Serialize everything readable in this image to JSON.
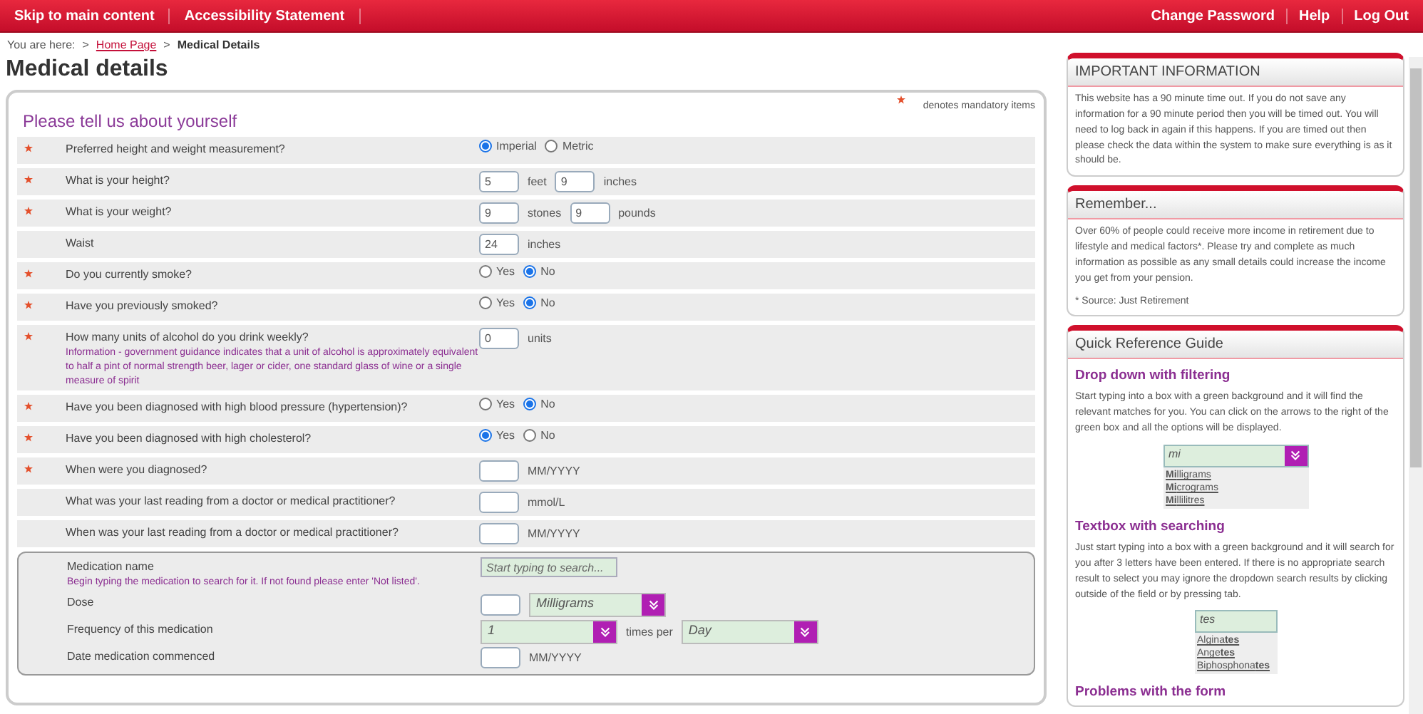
{
  "top_nav": {
    "left_links": [
      "Skip to main content",
      "Accessibility Statement"
    ],
    "right_links": [
      "Change Password",
      "Help",
      "Log Out"
    ]
  },
  "breadcrumb": {
    "prefix": "You are here:",
    "separator": ">",
    "links": [
      "Home Page"
    ],
    "current": "Medical Details"
  },
  "page_title": "Medical details",
  "form": {
    "mandatory_note": "denotes mandatory items",
    "section_title": "Please tell us about yourself",
    "rows": [
      {
        "label": "Preferred height and weight measurement?",
        "required": true,
        "controls": [
          {
            "kind": "radio",
            "label": "Imperial",
            "selected": true
          },
          {
            "kind": "radio",
            "label": "Metric",
            "selected": false
          }
        ]
      },
      {
        "label": "What is your height?",
        "required": true,
        "controls": [
          {
            "kind": "input",
            "value": "5"
          },
          {
            "kind": "unit",
            "text": "feet"
          },
          {
            "kind": "input",
            "value": "9"
          },
          {
            "kind": "unit",
            "text": "inches"
          }
        ]
      },
      {
        "label": "What is your weight?",
        "required": true,
        "controls": [
          {
            "kind": "input",
            "value": "9"
          },
          {
            "kind": "unit",
            "text": "stones"
          },
          {
            "kind": "input",
            "value": "9"
          },
          {
            "kind": "unit",
            "text": "pounds"
          }
        ]
      },
      {
        "label": "Waist",
        "required": false,
        "controls": [
          {
            "kind": "input",
            "value": "24"
          },
          {
            "kind": "unit",
            "text": "inches"
          }
        ]
      },
      {
        "label": "Do you currently smoke?",
        "required": true,
        "controls": [
          {
            "kind": "radio",
            "label": "Yes",
            "selected": false
          },
          {
            "kind": "radio",
            "label": "No",
            "selected": true
          }
        ]
      },
      {
        "label": "Have you previously smoked?",
        "required": true,
        "controls": [
          {
            "kind": "radio",
            "label": "Yes",
            "selected": false
          },
          {
            "kind": "radio",
            "label": "No",
            "selected": true
          }
        ]
      },
      {
        "label": "How many units of alcohol do you drink weekly?",
        "required": true,
        "info": "Information - government guidance indicates that a unit of alcohol is approximately equivalent to half a pint of normal strength beer, lager or cider, one standard glass of wine or a single measure of spirit",
        "controls": [
          {
            "kind": "input",
            "value": "0"
          },
          {
            "kind": "unit",
            "text": "units"
          }
        ]
      },
      {
        "label": "Have you been diagnosed with high blood pressure (hypertension)?",
        "required": true,
        "controls": [
          {
            "kind": "radio",
            "label": "Yes",
            "selected": false
          },
          {
            "kind": "radio",
            "label": "No",
            "selected": true
          }
        ]
      },
      {
        "label": "Have you been diagnosed with high cholesterol?",
        "required": true,
        "controls": [
          {
            "kind": "radio",
            "label": "Yes",
            "selected": true
          },
          {
            "kind": "radio",
            "label": "No",
            "selected": false
          }
        ]
      },
      {
        "label": "When were you diagnosed?",
        "required": true,
        "controls": [
          {
            "kind": "input"
          },
          {
            "kind": "unit",
            "text": "MM/YYYY"
          }
        ]
      },
      {
        "label": "What was your last reading from a doctor or medical practitioner?",
        "required": false,
        "controls": [
          {
            "kind": "input"
          },
          {
            "kind": "unit",
            "text": "mmol/L"
          }
        ]
      },
      {
        "label": "When was your last reading from a doctor or medical practitioner?",
        "required": false,
        "controls": [
          {
            "kind": "input"
          },
          {
            "kind": "unit",
            "text": "MM/YYYY"
          }
        ]
      }
    ],
    "medication": [
      {
        "label": "Medication name",
        "info": "Begin typing the medication to search for it. If not found please enter 'Not listed'.",
        "controls": [
          {
            "kind": "search",
            "placeholder": "Start typing to search..."
          }
        ]
      },
      {
        "label": "Dose",
        "controls": [
          {
            "kind": "input"
          },
          {
            "kind": "select",
            "value": "Milligrams"
          }
        ]
      },
      {
        "label": "Frequency of this medication",
        "controls": [
          {
            "kind": "select",
            "value": "1"
          },
          {
            "kind": "unit",
            "text": "times per"
          },
          {
            "kind": "select",
            "value": "Day"
          }
        ]
      },
      {
        "label": "Date medication commenced",
        "controls": [
          {
            "kind": "input"
          },
          {
            "kind": "unit",
            "text": "MM/YYYY"
          }
        ]
      }
    ]
  },
  "sidebar": [
    {
      "title": "IMPORTANT INFORMATION",
      "paragraphs": [
        "This website has a 90 minute time out. If you do not save any information for a 90 minute period then you will be timed out. You will need to log back in again if this happens. If you are timed out then please check the data within the system to make sure everything is as it should be."
      ]
    },
    {
      "title": "Remember...",
      "paragraphs": [
        "Over 60% of people could receive more income in retirement due to lifestyle and medical factors*. Please try and complete as much information as possible as any small details could increase the income you get from your pension.",
        "* Source: Just Retirement"
      ]
    },
    {
      "title": "Quick Reference Guide",
      "guides": [
        {
          "heading": "Drop down with filtering",
          "text": "Start typing into a box with a green background and it will find the relevant matches for you. You can click on the arrows to the right of the green box and all the options will be displayed.",
          "kind": "dropdown",
          "value": "mi",
          "options": [
            "**Mi**lligrams",
            "**Mi**crograms",
            "**Mi**llilitres"
          ]
        },
        {
          "heading": "Textbox with searching",
          "text": "Just start typing into a box with a green background and it will search for you after 3 letters have been entered. If there is no appropriate search result to select you may ignore the dropdown search results by clicking outside of the field or by pressing tab.",
          "kind": "search",
          "value": "tes",
          "options": [
            "Algina**tes**",
            "Ange**tes**",
            "Biphosphona**tes**"
          ]
        },
        {
          "heading": "Problems with the form",
          "kind": "heading"
        }
      ]
    }
  ]
}
